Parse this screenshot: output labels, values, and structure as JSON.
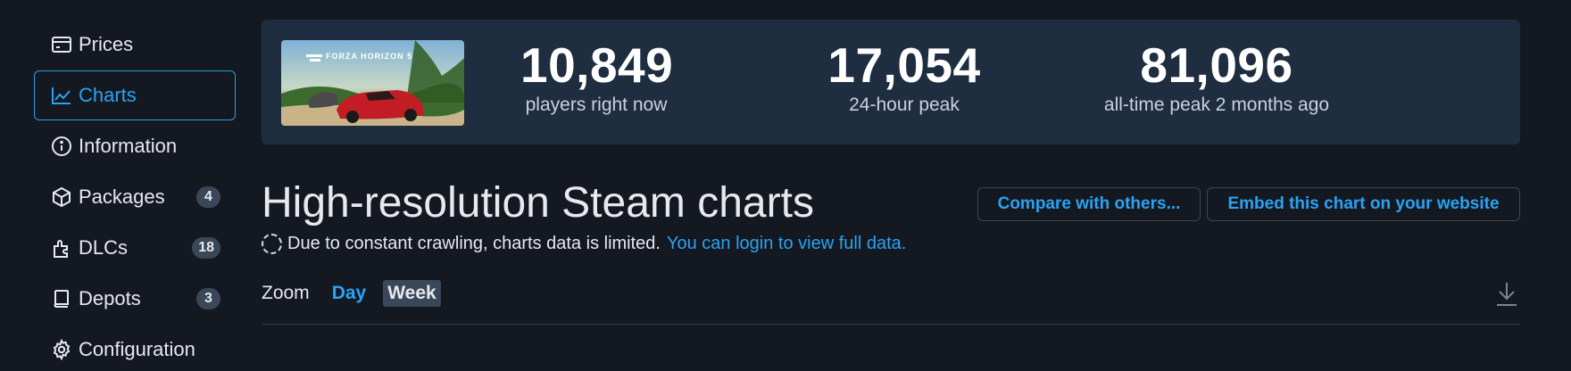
{
  "sidebar": {
    "items": [
      {
        "label": "Prices",
        "icon": "card-icon"
      },
      {
        "label": "Charts",
        "icon": "chart-line-icon",
        "active": true
      },
      {
        "label": "Information",
        "icon": "info-icon"
      },
      {
        "label": "Packages",
        "icon": "box-icon",
        "badge": "4"
      },
      {
        "label": "DLCs",
        "icon": "dlc-icon",
        "badge": "18"
      },
      {
        "label": "Depots",
        "icon": "depot-icon",
        "badge": "3"
      },
      {
        "label": "Configuration",
        "icon": "gear-icon"
      }
    ]
  },
  "stats": {
    "game_logo_text": "FORZA HORIZON 5",
    "current": {
      "value": "10,849",
      "label": "players right now"
    },
    "peak24": {
      "value": "17,054",
      "label": "24-hour peak"
    },
    "alltime": {
      "value": "81,096",
      "label": "all-time peak 2 months ago"
    }
  },
  "main": {
    "title": "High-resolution Steam charts",
    "compare_button": "Compare with others...",
    "embed_button": "Embed this chart on your website",
    "notice_text": "Due to constant crawling, charts data is limited.",
    "notice_link": "You can login to view full data.",
    "zoom_label": "Zoom",
    "zoom_day": "Day",
    "zoom_week": "Week"
  },
  "colors": {
    "background": "#141821",
    "card": "#1f2d40",
    "accent": "#2aa3f2",
    "badge": "#3a4758"
  }
}
